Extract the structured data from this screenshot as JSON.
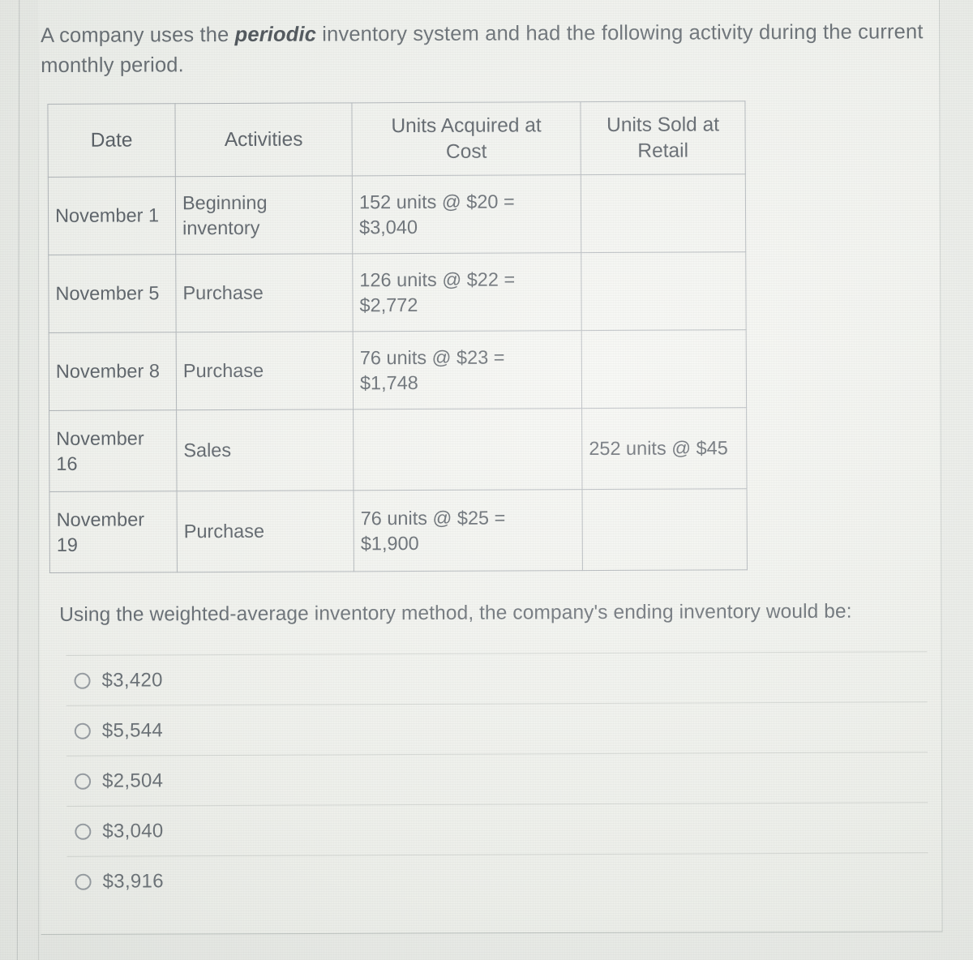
{
  "prompt": {
    "before": "A company uses the ",
    "emphasis": "periodic",
    "after": " inventory system and had the following activity during the current monthly period."
  },
  "table": {
    "headers": {
      "date": "Date",
      "activities": "Activities",
      "acquired_line1": "Units Acquired at",
      "acquired_line2": "Cost",
      "sold_line1": "Units Sold at",
      "sold_line2": "Retail"
    },
    "rows": [
      {
        "date": "November 1",
        "activity_line1": "Beginning",
        "activity_line2": "inventory",
        "acquired_line1": "152 units @ $20 =",
        "acquired_line2": "$3,040",
        "sold": ""
      },
      {
        "date": "November 5",
        "activity_line1": "Purchase",
        "activity_line2": "",
        "acquired_line1": "126 units @ $22 =",
        "acquired_line2": "$2,772",
        "sold": ""
      },
      {
        "date": "November 8",
        "activity_line1": "Purchase",
        "activity_line2": "",
        "acquired_line1": "76 units @ $23 =",
        "acquired_line2": "$1,748",
        "sold": ""
      },
      {
        "date_line1": "November",
        "date_line2": "16",
        "date": "November 16",
        "activity_line1": "Sales",
        "activity_line2": "",
        "acquired_line1": "",
        "acquired_line2": "",
        "sold": "252 units @ $45"
      },
      {
        "date_line1": "November",
        "date_line2": "19",
        "date": "November 19",
        "activity_line1": "Purchase",
        "activity_line2": "",
        "acquired_line1": "76 units @ $25 =",
        "acquired_line2": "$1,900",
        "sold": ""
      }
    ]
  },
  "question": "Using the weighted-average inventory method, the company's ending inventory would be:",
  "options": [
    {
      "label": "$3,420",
      "selected": false
    },
    {
      "label": "$5,544",
      "selected": false
    },
    {
      "label": "$2,504",
      "selected": false
    },
    {
      "label": "$3,040",
      "selected": false
    },
    {
      "label": "$3,916",
      "selected": false
    }
  ],
  "colors": {
    "page_background": "#f2f3ef",
    "text": "#4b525a",
    "table_border": "#a9aeb3",
    "divider": "#d3d6d2",
    "radio_outline": "#8d939a"
  }
}
